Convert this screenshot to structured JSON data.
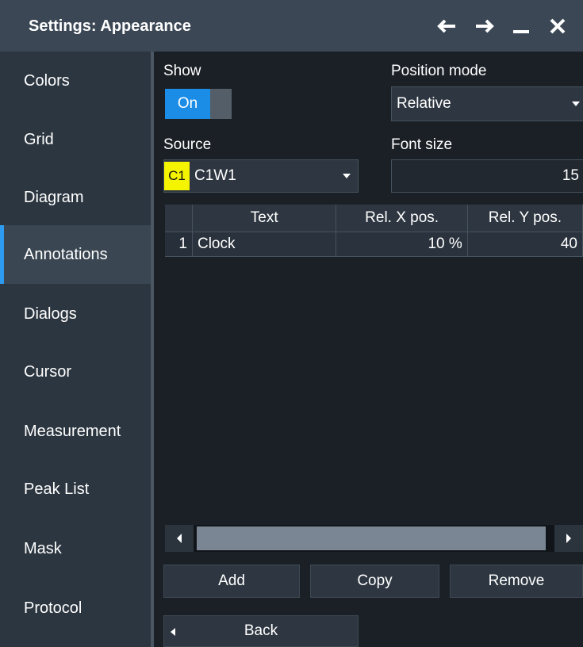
{
  "window": {
    "title": "Settings: Appearance",
    "icons": [
      "arrow-left-icon",
      "arrow-right-icon",
      "minimize-icon",
      "close-icon"
    ]
  },
  "sidebar": {
    "items": [
      {
        "label": "Colors"
      },
      {
        "label": "Grid"
      },
      {
        "label": "Diagram"
      },
      {
        "label": "Annotations",
        "active": true
      },
      {
        "label": "Dialogs"
      },
      {
        "label": "Cursor"
      },
      {
        "label": "Measurement"
      },
      {
        "label": "Peak List"
      },
      {
        "label": "Mask"
      },
      {
        "label": "Protocol"
      }
    ]
  },
  "form": {
    "show_label": "Show",
    "show_toggle": "On",
    "position_mode_label": "Position mode",
    "position_mode_value": "Relative",
    "source_label": "Source",
    "source_badge": "C1",
    "source_value": "C1W1",
    "font_size_label": "Font size",
    "font_size_value": "15"
  },
  "table": {
    "headers": [
      "",
      "Text",
      "Rel. X pos.",
      "Rel. Y pos."
    ],
    "rows": [
      [
        "1",
        "Clock",
        "10 %",
        "40"
      ]
    ]
  },
  "buttons": {
    "add": "Add",
    "copy": "Copy",
    "remove": "Remove",
    "back": "Back"
  },
  "colors": {
    "accent": "#1c8de6",
    "source_badge": "#f4f400",
    "background": "#1b2026",
    "sidebar": "#2c3640",
    "titlebar": "#3b4754"
  }
}
